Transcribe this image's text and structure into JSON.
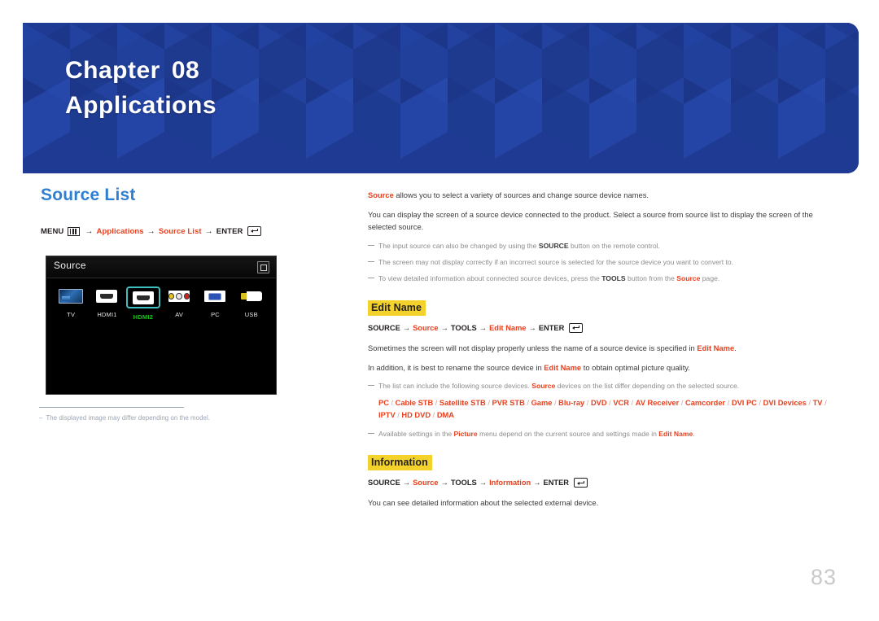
{
  "banner": {
    "chapter_label": "Chapter",
    "chapter_number": "08",
    "chapter_title": "Applications",
    "bg_color": "#1f3a93"
  },
  "left": {
    "section_title": "Source List",
    "menu_path": {
      "menu_label": "MENU",
      "menu_icon": "menu-bars-icon",
      "arrow": "→",
      "item1": "Applications",
      "item2": "Source List",
      "enter_label": "ENTER",
      "enter_icon": "enter-return-icon"
    },
    "source_screen": {
      "title": "Source",
      "return_icon": "return-box-icon",
      "items": [
        {
          "label": "TV",
          "icon": "tv-icon",
          "selected": false
        },
        {
          "label": "HDMI1",
          "icon": "hdmi-port-icon",
          "selected": false
        },
        {
          "label": "HDMI2",
          "icon": "hdmi-port-icon",
          "selected": true
        },
        {
          "label": "AV",
          "icon": "rca-av-icon",
          "selected": false
        },
        {
          "label": "PC",
          "icon": "vga-pc-icon",
          "selected": false
        },
        {
          "label": "USB",
          "icon": "usb-stick-icon",
          "selected": false
        }
      ],
      "selected_color": "#17c217",
      "highlight_border_color": "#3fbfbf"
    },
    "image_note": "The displayed image may differ depending on the model."
  },
  "right": {
    "intro": {
      "lead_red": "Source",
      "lead_rest": " allows you to select a variety of sources and change source device names.",
      "paragraph2": "You can display the screen of a source device connected to the product. Select a source from source list to display the screen of the selected source."
    },
    "notes_top": [
      {
        "pre": "The input source can also be changed by using the ",
        "bold": "SOURCE",
        "post": " button on the remote control."
      },
      {
        "pre": "The screen may not display correctly if an incorrect source is selected for the source device you want to convert to.",
        "bold": "",
        "post": ""
      },
      {
        "pre": "To view detailed information about connected source devices, press the ",
        "bold": "TOOLS",
        "mid": " button from the ",
        "red": "Source",
        "post": " page."
      }
    ],
    "edit_name": {
      "heading": "Edit Name",
      "path": {
        "p1": "SOURCE",
        "p2": "Source",
        "p3": "TOOLS",
        "p4": "Edit Name",
        "enter_label": "ENTER",
        "arrow": "→"
      },
      "para1_pre": "Sometimes the screen will not display properly unless the name of a source device is specified in ",
      "para1_red": "Edit Name",
      "para1_post": ".",
      "para2_pre": "In addition, it is best to rename the source device in ",
      "para2_red": "Edit Name",
      "para2_post": " to obtain optimal picture quality.",
      "list_note_pre": "The list can include the following source devices. ",
      "list_note_red": "Source",
      "list_note_post": " devices on the list differ depending on the selected source.",
      "device_list": [
        "PC",
        "Cable STB",
        "Satellite STB",
        "PVR STB",
        "Game",
        "Blu-ray",
        "DVD",
        "VCR",
        "AV Receiver",
        "Camcorder",
        "DVI PC",
        "DVI Devices",
        "TV",
        "IPTV",
        "HD DVD",
        "DMA"
      ],
      "picture_note_pre": "Available settings in the ",
      "picture_note_red1": "Picture",
      "picture_note_mid": " menu depend on the current source and settings made in ",
      "picture_note_red2": "Edit Name",
      "picture_note_post": "."
    },
    "information": {
      "heading": "Information",
      "path": {
        "p1": "SOURCE",
        "p2": "Source",
        "p3": "TOOLS",
        "p4": "Information",
        "enter_label": "ENTER",
        "arrow": "→"
      },
      "description": "You can see detailed information about the selected external device."
    }
  },
  "page_number": "83",
  "colors": {
    "accent_red": "#e8401f",
    "heading_blue": "#2f7fd1",
    "highlight_yellow": "#f2d22b",
    "note_gray": "#8d8d8d"
  }
}
